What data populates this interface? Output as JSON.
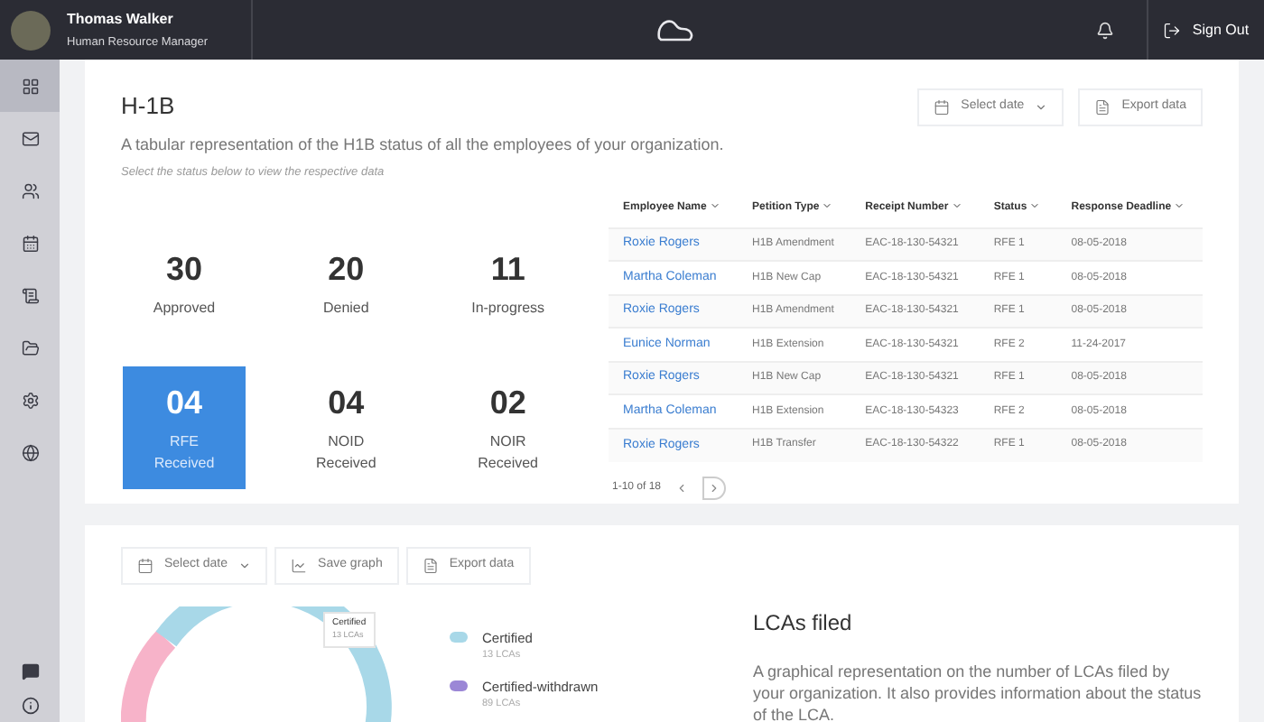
{
  "user": {
    "name": "Thomas Walker",
    "role": "Human Resource Manager"
  },
  "header": {
    "sign_out": "Sign Out"
  },
  "sidebar": {
    "items": [
      {
        "selected": true
      },
      {
        "selected": false
      },
      {
        "selected": false
      },
      {
        "selected": false
      },
      {
        "selected": false
      },
      {
        "selected": false
      },
      {
        "selected": false
      },
      {
        "selected": false
      }
    ]
  },
  "h1b": {
    "title": "H-1B",
    "description": "A tabular representation of the H1B status of all the employees of your organization.",
    "hint": "Select the status below to view the respective data",
    "select_date": "Select date",
    "export": "Export data",
    "stats": [
      {
        "value": "30",
        "label": "Approved",
        "selected": false
      },
      {
        "value": "20",
        "label": "Denied",
        "selected": false
      },
      {
        "value": "11",
        "label": "In-progress",
        "selected": false
      },
      {
        "value": "04",
        "label": "RFE Received",
        "selected": true
      },
      {
        "value": "04",
        "label": "NOID Received",
        "selected": false
      },
      {
        "value": "02",
        "label": "NOIR Received",
        "selected": false
      }
    ],
    "table": {
      "columns": [
        "Employee Name",
        "Petition Type",
        "Receipt Number",
        "Status",
        "Response Deadline"
      ],
      "rows": [
        [
          "Roxie Rogers",
          "H1B Amendment",
          "EAC-18-130-54321",
          "RFE 1",
          "08-05-2018"
        ],
        [
          "Martha Coleman",
          "H1B New Cap",
          "EAC-18-130-54321",
          "RFE 1",
          "08-05-2018"
        ],
        [
          "Roxie Rogers",
          "H1B Amendment",
          "EAC-18-130-54321",
          "RFE 1",
          "08-05-2018"
        ],
        [
          "Eunice Norman",
          "H1B Extension",
          "EAC-18-130-54321",
          "RFE 2",
          "11-24-2017"
        ],
        [
          "Roxie Rogers",
          "H1B New Cap",
          "EAC-18-130-54321",
          "RFE 1",
          "08-05-2018"
        ],
        [
          "Martha Coleman",
          "H1B Extension",
          "EAC-18-130-54323",
          "RFE 2",
          "08-05-2018"
        ],
        [
          "Roxie Rogers",
          "H1B Transfer",
          "EAC-18-130-54322",
          "RFE 1",
          "08-05-2018"
        ]
      ],
      "pagination": "1-10 of 18"
    }
  },
  "lca": {
    "select_date": "Select date",
    "save_graph": "Save graph",
    "export": "Export data",
    "tooltip": {
      "title": "Certified",
      "subtitle": "13 LCAs"
    },
    "legend": [
      {
        "label": "Certified",
        "count": "13 LCAs",
        "color": "#a8d8e8"
      },
      {
        "label": "Certified-withdrawn",
        "count": "89 LCAs",
        "color": "#9b87d6"
      }
    ],
    "title": "LCAs filed",
    "description": "A graphical representation on the number of LCAs filed by your organization. It also provides information about the status of the LCA."
  }
}
